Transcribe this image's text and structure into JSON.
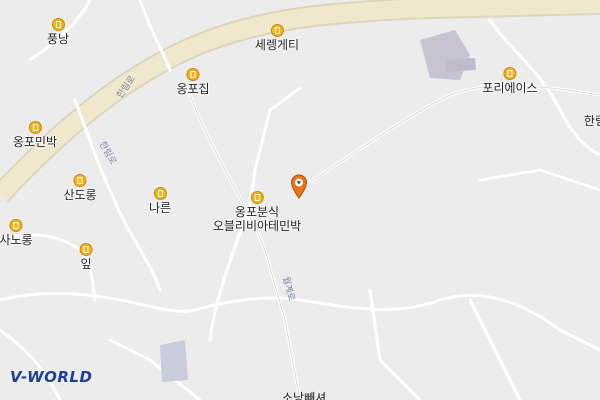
{
  "pois": [
    {
      "label": "풍낭"
    },
    {
      "label": "세렝게티"
    },
    {
      "label": "옹포집"
    },
    {
      "label": "포리에이스"
    },
    {
      "label": "옹포민박"
    },
    {
      "label": "산도롱"
    },
    {
      "label": "나른"
    },
    {
      "label": "옹포분식"
    },
    {
      "label": "사노롱"
    },
    {
      "label": "잎"
    }
  ],
  "poi_extra_label": "오블리비아테민박",
  "edge_label": "한림",
  "bottom_label": "소낭빼셔",
  "road_labels": [
    "한림로",
    "한림로",
    "월계로"
  ],
  "logo": "V-WORLD",
  "marker": {
    "icon": "location-pin-icon"
  },
  "colors": {
    "background": "#ececec",
    "main_road": "#efe5c6",
    "poi": "#f2b21a",
    "marker": "#e8731a"
  }
}
